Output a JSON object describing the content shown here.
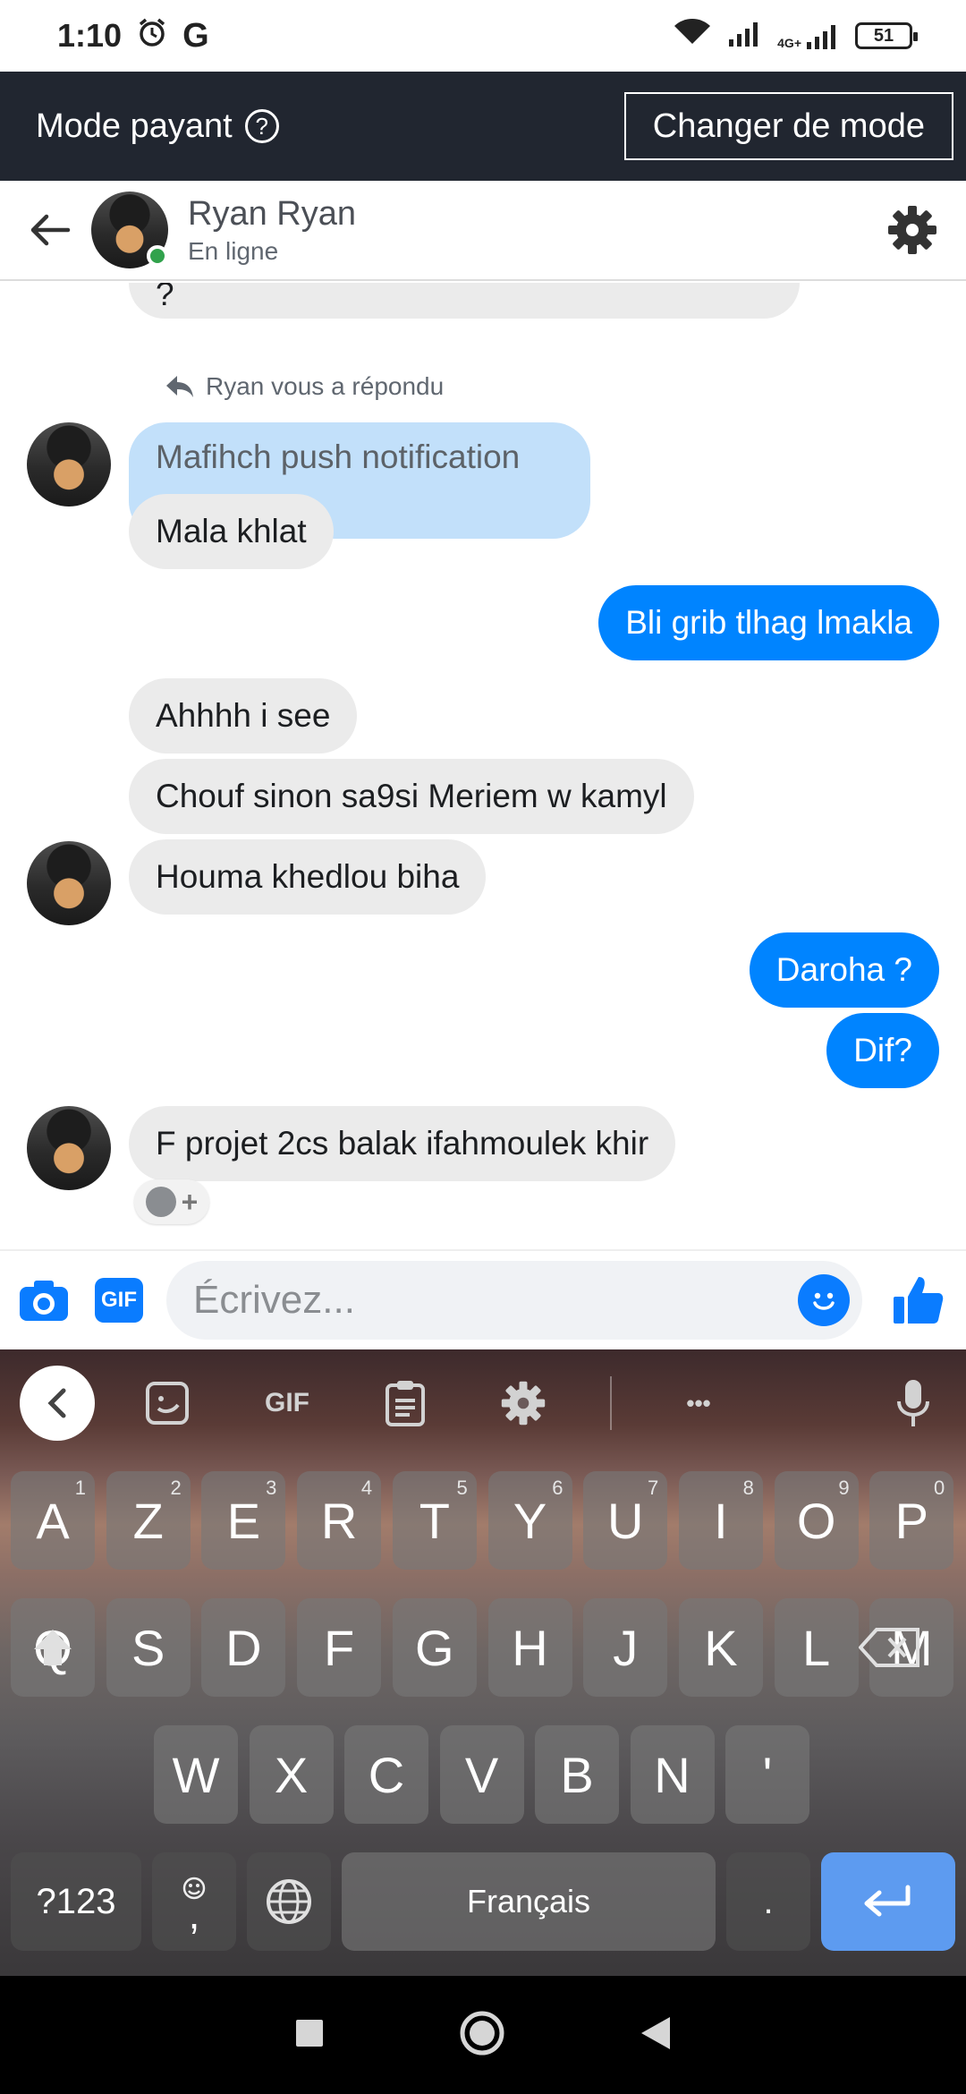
{
  "status_bar": {
    "time": "1:10",
    "battery": "51",
    "network": "4G+",
    "carrier_icon": "G"
  },
  "mode_banner": {
    "title": "Mode payant",
    "help_glyph": "?",
    "change_button": "Changer de mode"
  },
  "chat_header": {
    "name": "Ryan Ryan",
    "status": "En ligne"
  },
  "conversation": {
    "top_partial": "?",
    "replied_note": "Ryan vous a répondu",
    "quoted_reply": "Mafihch push notification",
    "messages": [
      {
        "text": "Mala khlat",
        "dir": "in"
      },
      {
        "text": "Bli grib tlhag lmakla",
        "dir": "out"
      },
      {
        "text": "Ahhhh i see",
        "dir": "in"
      },
      {
        "text": "Chouf sinon sa9si Meriem w kamyl",
        "dir": "in"
      },
      {
        "text": "Houma khedlou biha",
        "dir": "in"
      },
      {
        "text": "Daroha ?",
        "dir": "out"
      },
      {
        "text": "Dif?",
        "dir": "out"
      },
      {
        "text": "F projet 2cs balak ifahmoulek khir",
        "dir": "in"
      }
    ],
    "reaction_plus": "+"
  },
  "composer": {
    "gif_label": "GIF",
    "placeholder": "Écrivez..."
  },
  "keyboard": {
    "toolbar_gif": "GIF",
    "toolbar_more": "•••",
    "row1": [
      {
        "key": "A",
        "hint": "1"
      },
      {
        "key": "Z",
        "hint": "2"
      },
      {
        "key": "E",
        "hint": "3"
      },
      {
        "key": "R",
        "hint": "4"
      },
      {
        "key": "T",
        "hint": "5"
      },
      {
        "key": "Y",
        "hint": "6"
      },
      {
        "key": "U",
        "hint": "7"
      },
      {
        "key": "I",
        "hint": "8"
      },
      {
        "key": "O",
        "hint": "9"
      },
      {
        "key": "P",
        "hint": "0"
      }
    ],
    "row2": [
      "Q",
      "S",
      "D",
      "F",
      "G",
      "H",
      "J",
      "K",
      "L",
      "M"
    ],
    "row3": [
      "W",
      "X",
      "C",
      "V",
      "B",
      "N",
      "'"
    ],
    "symbols_key": "?123",
    "comma_key": ",",
    "space_label": "Français",
    "period_key": "."
  },
  "colors": {
    "accent": "#0084ff",
    "banner_bg": "#212630",
    "reply_bubble": "#c2e0fa",
    "incoming_bubble": "#ebebeb",
    "online": "#31a24c",
    "enter_key": "#5d9bf0"
  },
  "icons": [
    "wifi-icon",
    "signal-icon",
    "alarm-icon",
    "back-arrow-icon",
    "settings-gear-icon",
    "reply-icon",
    "camera-icon",
    "emoji-icon",
    "thumbs-up-icon",
    "sticker-icon",
    "clipboard-icon",
    "mic-icon",
    "globe-icon",
    "shift-icon",
    "backspace-icon",
    "enter-icon",
    "nav-recents-icon",
    "nav-home-icon",
    "nav-back-icon"
  ]
}
